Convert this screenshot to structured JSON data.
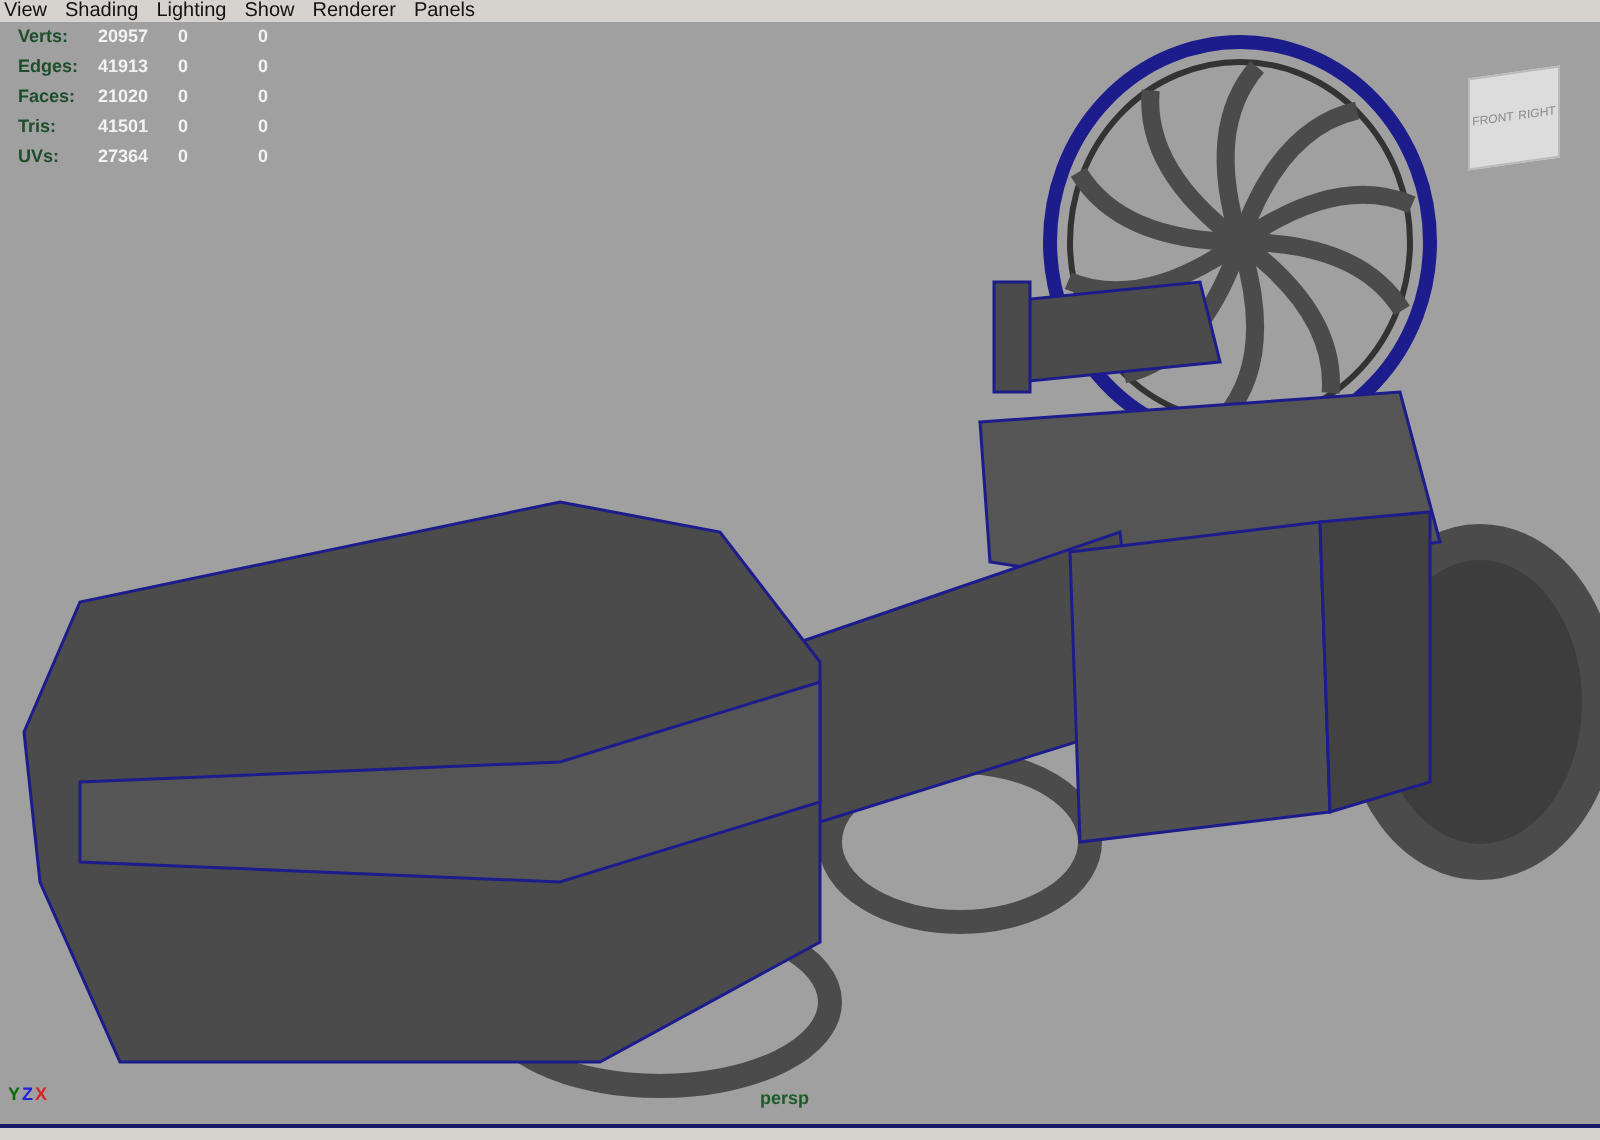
{
  "menu": [
    "View",
    "Shading",
    "Lighting",
    "Show",
    "Renderer",
    "Panels"
  ],
  "stats": [
    {
      "label": "Verts:",
      "values": [
        "20957",
        "0",
        "0"
      ]
    },
    {
      "label": "Edges:",
      "values": [
        "41913",
        "0",
        "0"
      ]
    },
    {
      "label": "Faces:",
      "values": [
        "21020",
        "0",
        "0"
      ]
    },
    {
      "label": "Tris:",
      "values": [
        "41501",
        "0",
        "0"
      ]
    },
    {
      "label": "UVs:",
      "values": [
        "27364",
        "0",
        "0"
      ]
    }
  ],
  "view_cube": {
    "faces": [
      "FRONT",
      "RIGHT"
    ]
  },
  "axes": [
    {
      "label": "Y",
      "color": "#0b6b0b"
    },
    {
      "label": "Z",
      "color": "#2222dd"
    },
    {
      "label": "X",
      "color": "#dd2222"
    }
  ],
  "camera_label": "persp"
}
